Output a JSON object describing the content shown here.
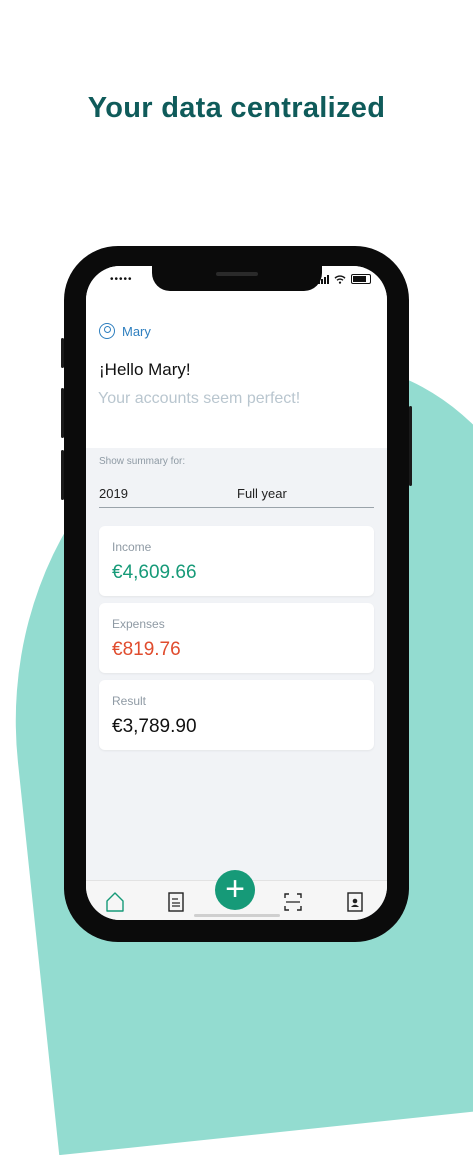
{
  "headline": "Your data centralized",
  "status": {
    "signal_dots": "•••••"
  },
  "user": {
    "name": "Mary"
  },
  "greeting": "¡Hello Mary!",
  "subtitle": "Your accounts seem perfect!",
  "summary": {
    "label": "Show summary for:",
    "year": "2019",
    "period": "Full year"
  },
  "cards": [
    {
      "label": "Income",
      "value": "€4,609.66",
      "color": "#169a78"
    },
    {
      "label": "Expenses",
      "value": "€819.76",
      "color": "#e04c2e"
    },
    {
      "label": "Result",
      "value": "€3,789.90",
      "color": "#111111"
    }
  ],
  "tabbar": {
    "items": [
      "home-icon",
      "documents-icon",
      "add-icon",
      "scan-icon",
      "contacts-icon"
    ],
    "fab_label": "+"
  },
  "colors": {
    "accent": "#169a78",
    "brand_dark": "#0f5b5a",
    "blob": "#93dcd0"
  }
}
